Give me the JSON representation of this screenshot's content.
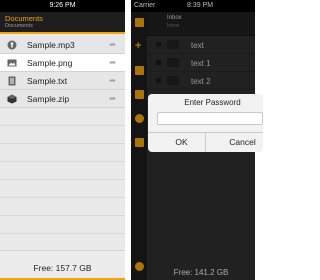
{
  "left": {
    "status_time": "9:26 PM",
    "title": "Documents",
    "subtitle": "Documents",
    "files": [
      {
        "name": "Sample.mp3",
        "icon": "audio-icon"
      },
      {
        "name": "Sample.png",
        "icon": "image-icon"
      },
      {
        "name": "Sample.txt",
        "icon": "text-file-icon"
      },
      {
        "name": "Sample.zip",
        "icon": "archive-icon"
      }
    ],
    "footer": "Free: 157.7 GB"
  },
  "right": {
    "carrier": "Carrier",
    "status_time": "8:39 PM",
    "bar_title": "Inbox",
    "bar_subtitle": "Inbox",
    "files": [
      {
        "name": "text"
      },
      {
        "name": "text 1"
      },
      {
        "name": "text 2"
      }
    ],
    "footer": "Free: 141.2 GB",
    "dialog": {
      "title": "Enter Password",
      "password_value": "",
      "ok_label": "OK",
      "cancel_label": "Cancel"
    }
  },
  "colors": {
    "accent": "#f0a30a",
    "dark_bg": "#2f2f2f"
  }
}
